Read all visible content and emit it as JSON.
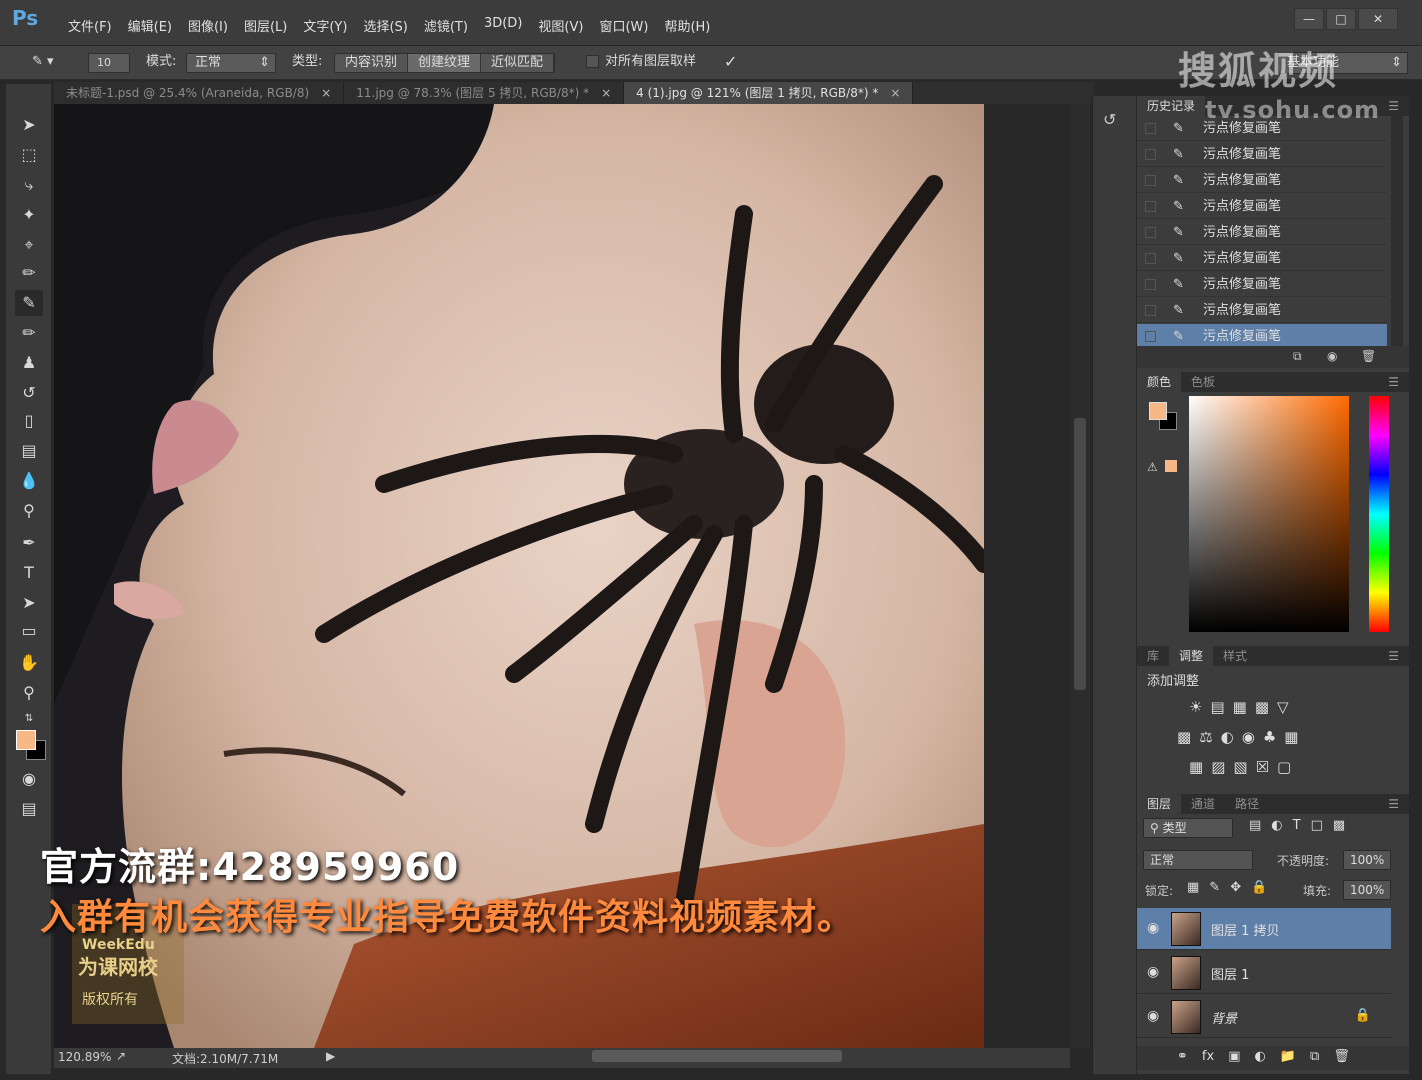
{
  "app": {
    "logo": "Ps",
    "menu": [
      "文件(F)",
      "编辑(E)",
      "图像(I)",
      "图层(L)",
      "文字(Y)",
      "选择(S)",
      "滤镜(T)",
      "3D(D)",
      "视图(V)",
      "窗口(W)",
      "帮助(H)"
    ],
    "window_buttons": [
      "minimize-icon",
      "restore-icon",
      "close-icon"
    ]
  },
  "options": {
    "brush_size": "10",
    "mode_label": "模式:",
    "mode_value": "正常",
    "type_label": "类型:",
    "type_options": [
      "内容识别",
      "创建纹理",
      "近似匹配"
    ],
    "type_selected": "创建纹理",
    "sample_all_label": "对所有图层取样",
    "workspace": "基本功能"
  },
  "watermark": {
    "brand": "搜狐视频",
    "url": "tv.sohu.com"
  },
  "tabs": [
    {
      "title": "未标题-1.psd @ 25.4% (Araneida, RGB/8)",
      "close": "×"
    },
    {
      "title": "11.jpg @ 78.3% (图层 5 拷贝, RGB/8*) *",
      "close": "×"
    },
    {
      "title": "4 (1).jpg @ 121% (图层 1 拷贝, RGB/8*) *",
      "close": "×"
    }
  ],
  "status": {
    "zoom": "120.89%",
    "doc": "文档:2.10M/7.71M"
  },
  "promo": {
    "line1": "官方流群:428959960",
    "line2": "入群有机会获得专业指导免费软件资料视频素材。"
  },
  "history": {
    "tab": "历史记录",
    "rows": [
      "污点修复画笔",
      "污点修复画笔",
      "污点修复画笔",
      "污点修复画笔",
      "污点修复画笔",
      "污点修复画笔",
      "污点修复画笔",
      "污点修复画笔",
      "污点修复画笔"
    ]
  },
  "color": {
    "tabs": [
      "颜色",
      "色板"
    ],
    "foreground": "#f7b887",
    "background": "#000000"
  },
  "adjustments": {
    "tabs": [
      "库",
      "调整",
      "样式"
    ],
    "title": "添加调整"
  },
  "layers": {
    "tabs": [
      "图层",
      "通道",
      "路径"
    ],
    "filter_kind": "类型",
    "blend_mode": "正常",
    "opacity_label": "不透明度:",
    "opacity_value": "100%",
    "lock_label": "锁定:",
    "fill_label": "填充:",
    "fill_value": "100%",
    "items": [
      {
        "name": "图层 1 拷贝"
      },
      {
        "name": "图层 1"
      },
      {
        "name": "背景"
      }
    ]
  },
  "watermark_logo": {
    "line1": "WeekEdu",
    "line2": "为课网校",
    "stamp": "版权所有"
  }
}
